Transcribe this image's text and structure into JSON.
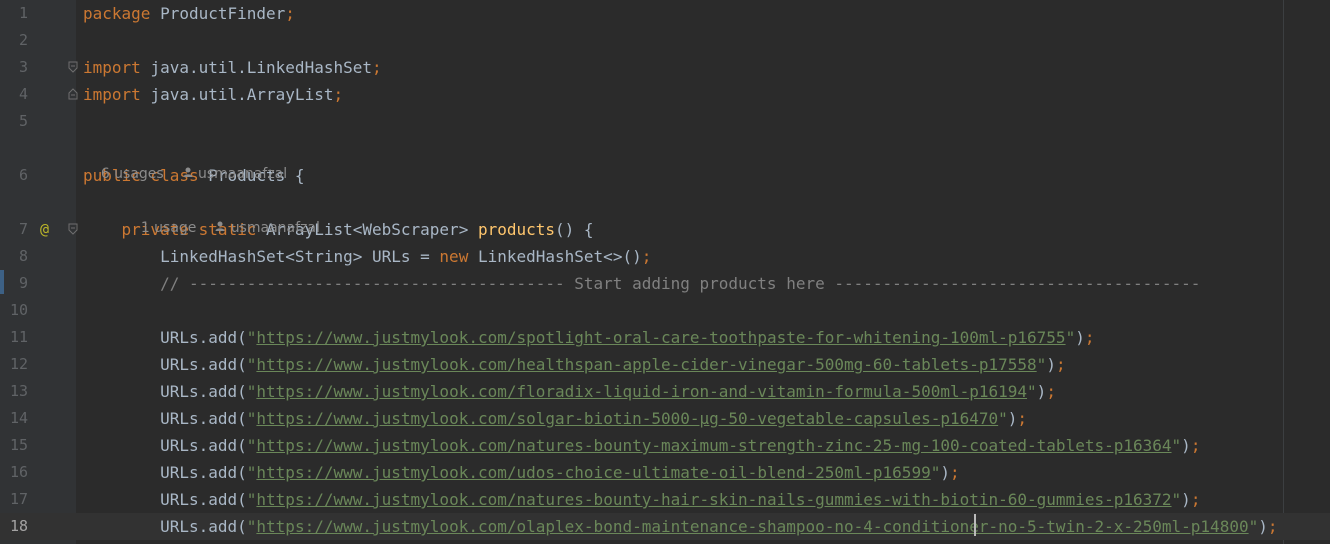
{
  "editor": {
    "current_line": "18",
    "lines": [
      {
        "n": "1",
        "parts": [
          [
            "kw",
            "package "
          ],
          [
            "txt",
            "ProductFinder"
          ],
          [
            "kw",
            ";"
          ]
        ]
      },
      {
        "n": "2",
        "parts": []
      },
      {
        "n": "3",
        "parts": [
          [
            "kw",
            "import "
          ],
          [
            "txt",
            "java.util.LinkedHashSet"
          ],
          [
            "kw",
            ";"
          ]
        ]
      },
      {
        "n": "4",
        "parts": [
          [
            "kw",
            "import "
          ],
          [
            "txt",
            "java.util.ArrayList"
          ],
          [
            "kw",
            ";"
          ]
        ]
      },
      {
        "n": "5",
        "parts": []
      },
      {
        "n": "6",
        "parts": [
          [
            "kw",
            "public class "
          ],
          [
            "txt",
            "Products {"
          ]
        ]
      },
      {
        "n": "7",
        "parts": [
          [
            "txt",
            "    "
          ],
          [
            "kw",
            "private static "
          ],
          [
            "txt",
            "ArrayList<WebScraper> "
          ],
          [
            "fn",
            "products"
          ],
          [
            "txt",
            "() {"
          ]
        ]
      },
      {
        "n": "8",
        "parts": [
          [
            "txt",
            "        LinkedHashSet<String> URLs = "
          ],
          [
            "kw",
            "new "
          ],
          [
            "txt",
            "LinkedHashSet<>()"
          ],
          [
            "kw",
            ";"
          ]
        ]
      },
      {
        "n": "9",
        "parts": [
          [
            "txt",
            "        "
          ],
          [
            "cmt",
            "// --------------------------------------- Start adding products here --------------------------------------"
          ]
        ]
      },
      {
        "n": "10",
        "parts": []
      },
      {
        "n": "11",
        "parts": [
          [
            "txt",
            "        URLs.add("
          ],
          [
            "str",
            "\""
          ],
          [
            "url",
            "https://www.justmylook.com/spotlight-oral-care-toothpaste-for-whitening-100ml-p16755"
          ],
          [
            "str",
            "\""
          ],
          [
            "txt",
            ")"
          ],
          [
            "kw",
            ";"
          ]
        ]
      },
      {
        "n": "12",
        "parts": [
          [
            "txt",
            "        URLs.add("
          ],
          [
            "str",
            "\""
          ],
          [
            "url",
            "https://www.justmylook.com/healthspan-apple-cider-vinegar-500mg-60-tablets-p17558"
          ],
          [
            "str",
            "\""
          ],
          [
            "txt",
            ")"
          ],
          [
            "kw",
            ";"
          ]
        ]
      },
      {
        "n": "13",
        "parts": [
          [
            "txt",
            "        URLs.add("
          ],
          [
            "str",
            "\""
          ],
          [
            "url",
            "https://www.justmylook.com/floradix-liquid-iron-and-vitamin-formula-500ml-p16194"
          ],
          [
            "str",
            "\""
          ],
          [
            "txt",
            ")"
          ],
          [
            "kw",
            ";"
          ]
        ]
      },
      {
        "n": "14",
        "parts": [
          [
            "txt",
            "        URLs.add("
          ],
          [
            "str",
            "\""
          ],
          [
            "url",
            "https://www.justmylook.com/solgar-biotin-5000-µg-50-vegetable-capsules-p16470"
          ],
          [
            "str",
            "\""
          ],
          [
            "txt",
            ")"
          ],
          [
            "kw",
            ";"
          ]
        ]
      },
      {
        "n": "15",
        "parts": [
          [
            "txt",
            "        URLs.add("
          ],
          [
            "str",
            "\""
          ],
          [
            "url",
            "https://www.justmylook.com/natures-bounty-maximum-strength-zinc-25-mg-100-coated-tablets-p16364"
          ],
          [
            "str",
            "\""
          ],
          [
            "txt",
            ")"
          ],
          [
            "kw",
            ";"
          ]
        ]
      },
      {
        "n": "16",
        "parts": [
          [
            "txt",
            "        URLs.add("
          ],
          [
            "str",
            "\""
          ],
          [
            "url",
            "https://www.justmylook.com/udos-choice-ultimate-oil-blend-250ml-p16599"
          ],
          [
            "str",
            "\""
          ],
          [
            "txt",
            ")"
          ],
          [
            "kw",
            ";"
          ]
        ]
      },
      {
        "n": "17",
        "parts": [
          [
            "txt",
            "        URLs.add("
          ],
          [
            "str",
            "\""
          ],
          [
            "url",
            "https://www.justmylook.com/natures-bounty-hair-skin-nails-gummies-with-biotin-60-gummies-p16372"
          ],
          [
            "str",
            "\""
          ],
          [
            "txt",
            ")"
          ],
          [
            "kw",
            ";"
          ]
        ]
      },
      {
        "n": "18",
        "parts": [
          [
            "txt",
            "        URLs.add("
          ],
          [
            "str",
            "\""
          ],
          [
            "url",
            "https://www.justmylook.com/olaplex-bond-maintenance-shampoo-no-4-conditioner-no-5-twin-2-x-250ml-p14800"
          ],
          [
            "str",
            "\""
          ],
          [
            "txt",
            ")"
          ],
          [
            "kw",
            ";"
          ]
        ]
      }
    ]
  },
  "hints": {
    "class_hint": {
      "usages": "6 usages",
      "author": "usmaanafzal"
    },
    "method_hint": {
      "usages": "1 usage",
      "author": "usmaanafzal"
    }
  },
  "gutter": {
    "override_marker": "@",
    "override_marker_line": "7",
    "fold_icon": "fold-marker-icon",
    "user_icon": "user-icon"
  },
  "colors": {
    "background": "#2b2b2b",
    "gutter": "#313335",
    "keyword": "#cc7832",
    "string": "#6a8759",
    "comment": "#808080",
    "method": "#ffc66d",
    "text": "#a9b7c6",
    "line_number": "#606366"
  }
}
